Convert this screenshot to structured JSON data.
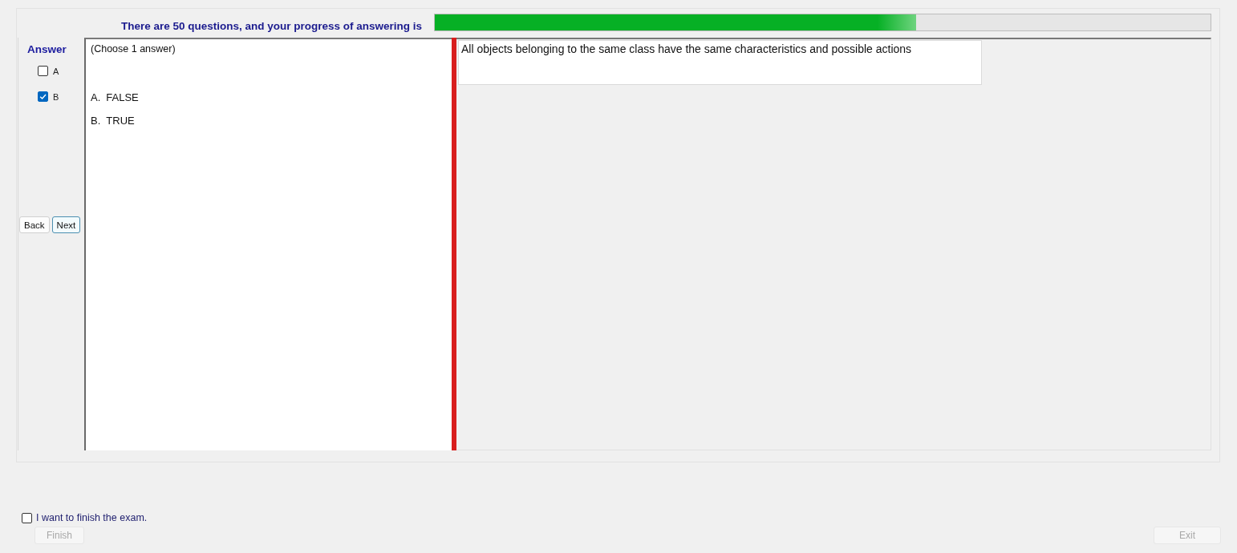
{
  "header": {
    "text": "There are 50 questions, and your progress of answering is",
    "progress": {
      "level": 0.62
    }
  },
  "answer_panel": {
    "title": "Answer",
    "choices": [
      {
        "label": "A",
        "checked": false
      },
      {
        "label": "B",
        "checked": true
      }
    ],
    "buttons": [
      {
        "label": "Back",
        "focused": false
      },
      {
        "label": "Next",
        "focused": true
      }
    ]
  },
  "options_panel": {
    "instruction": "(Choose 1 answer)",
    "options": [
      {
        "letter": "A.",
        "text": "FALSE"
      },
      {
        "letter": "B.",
        "text": "TRUE"
      }
    ]
  },
  "question": {
    "text": "All objects belonging to the same class have the same characteristics and possible actions"
  },
  "footer": {
    "finish_checkbox": {
      "label": "I want to finish the exam.",
      "checked": false
    },
    "finish_button": {
      "label": "Finish",
      "disabled": true
    },
    "exit_button": {
      "label": "Exit",
      "disabled": true
    }
  }
}
